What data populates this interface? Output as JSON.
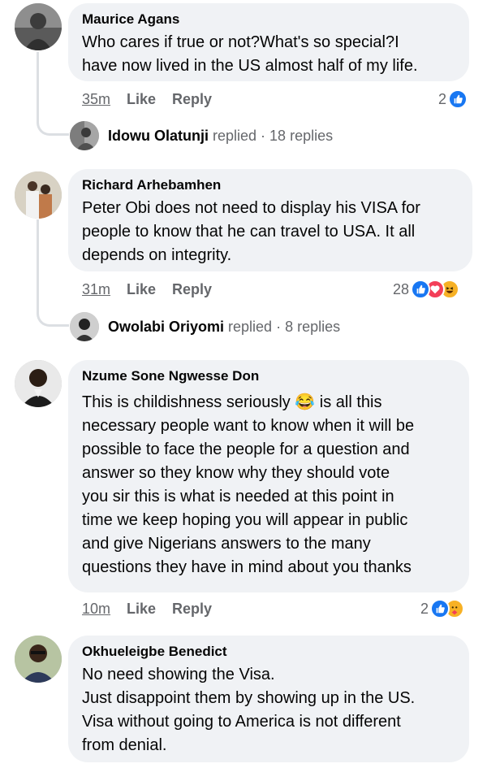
{
  "comments": [
    {
      "author": "Maurice Agans",
      "text": "Who cares if true or not?What's so special?I\nhave now lived in the US almost half of my life.",
      "time": "35m",
      "like": "Like",
      "reply": "Reply",
      "reaction_count": "2",
      "reactions": [
        "like-icon"
      ],
      "replies_summary": {
        "name": "Idowu Olatunji",
        "replied": "replied",
        "count": "18 replies"
      }
    },
    {
      "author": "Richard Arhebamhen",
      "text": "Peter Obi does not need to display his VISA for\npeople to know that he can travel to USA. It all\ndepends on integrity.",
      "time": "31m",
      "like": "Like",
      "reply": "Reply",
      "reaction_count": "28",
      "reactions": [
        "like-icon",
        "love-icon",
        "haha-icon"
      ],
      "replies_summary": {
        "name": "Owolabi Oriyomi",
        "replied": "replied",
        "count": "8 replies"
      }
    },
    {
      "author": "Nzume Sone Ngwesse Don",
      "text": "This is childishness seriously 😂 is all this\nnecessary people want to know when it will be\npossible to face the people for a question and\nanswer so they know why they should vote\nyou sir this is what is needed at this point in\ntime we keep hoping you will appear in public\nand give Nigerians answers to the many\nquestions they have in mind about you thanks",
      "time": "10m",
      "like": "Like",
      "reply": "Reply",
      "reaction_count": "2",
      "reactions": [
        "like-icon",
        "care-icon"
      ]
    },
    {
      "author": "Okhueleigbe Benedict",
      "text": "No need showing the Visa.\nJust disappoint them by showing up in the US.\nVisa without going to America is not different\nfrom denial."
    }
  ],
  "colors": {
    "bubble": "#f0f2f5",
    "meta": "#65676b",
    "like_blue": "#1877f2",
    "love_red": "#f33e58",
    "haha_yellow": "#f7b125"
  }
}
